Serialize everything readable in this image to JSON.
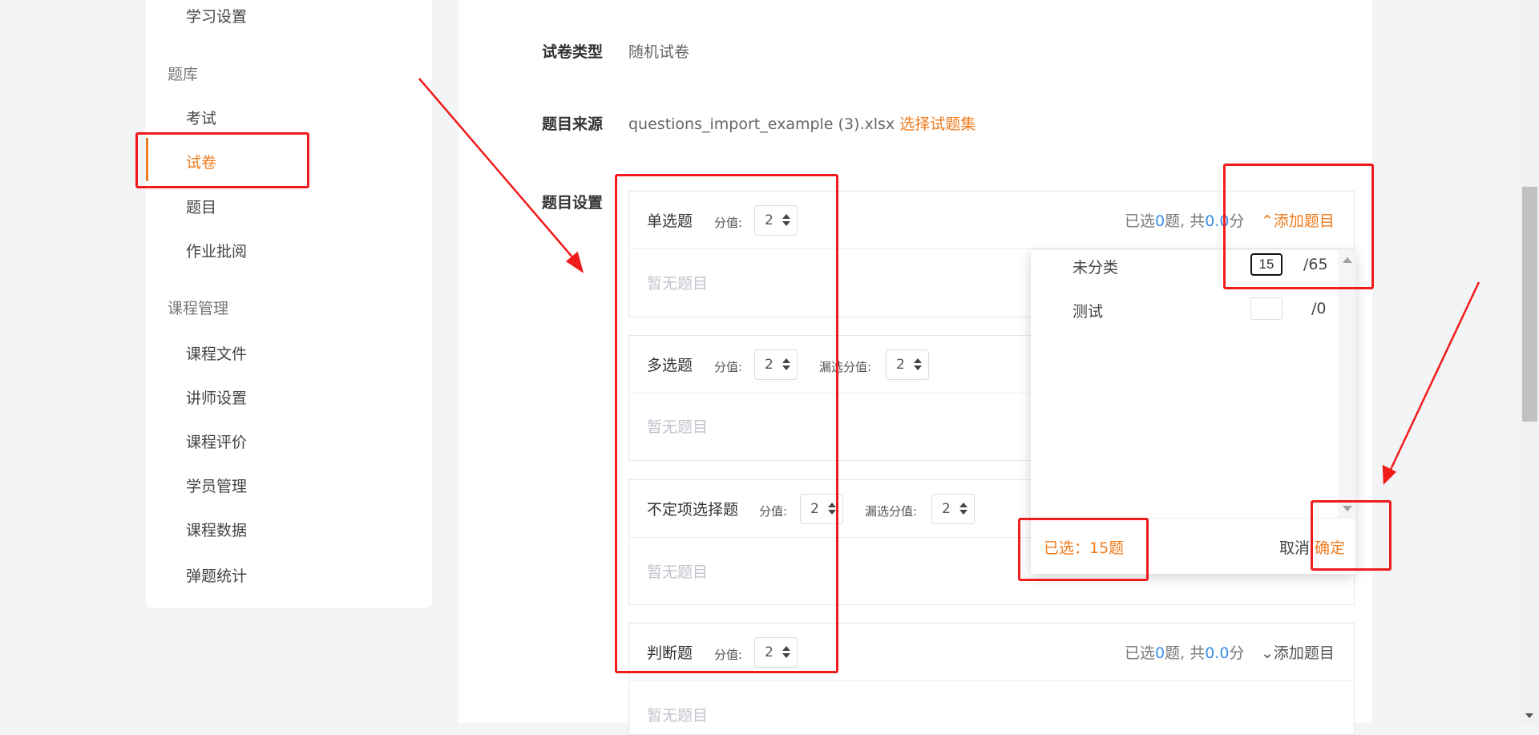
{
  "sidebar": {
    "items": [
      {
        "label": "学习设置",
        "type": "item"
      },
      {
        "label": "题库",
        "type": "group"
      },
      {
        "label": "考试",
        "type": "item"
      },
      {
        "label": "试卷",
        "type": "item",
        "active": true
      },
      {
        "label": "题目",
        "type": "item"
      },
      {
        "label": "作业批阅",
        "type": "item"
      },
      {
        "label": "课程管理",
        "type": "group"
      },
      {
        "label": "课程文件",
        "type": "item"
      },
      {
        "label": "讲师设置",
        "type": "item"
      },
      {
        "label": "课程评价",
        "type": "item"
      },
      {
        "label": "学员管理",
        "type": "item"
      },
      {
        "label": "课程数据",
        "type": "item"
      },
      {
        "label": "弹题统计",
        "type": "item"
      }
    ]
  },
  "form": {
    "paper_type_label": "试卷类型",
    "paper_type_value": "随机试卷",
    "source_label": "题目来源",
    "source_file": "questions_import_example (3).xlsx",
    "source_link": "选择试题集",
    "settings_label": "题目设置"
  },
  "question_types": [
    {
      "title": "单选题",
      "score_label": "分值:",
      "score": "2",
      "stat_prefix": "已选",
      "count": "0",
      "stat_mid": "题, 共",
      "points": "0.0",
      "stat_suffix": "分",
      "add_label": "添加题目",
      "empty": "暂无题目"
    },
    {
      "title": "多选题",
      "score_label": "分值:",
      "score": "2",
      "partial_label": "漏选分值:",
      "partial": "2",
      "empty": "暂无题目"
    },
    {
      "title": "不定项选择题",
      "score_label": "分值:",
      "score": "2",
      "partial_label": "漏选分值:",
      "partial": "2",
      "empty": "暂无题目"
    },
    {
      "title": "判断题",
      "score_label": "分值:",
      "score": "2",
      "stat_prefix": "已选",
      "count": "0",
      "stat_mid": "题, 共",
      "points": "0.0",
      "stat_suffix": "分",
      "add_label": "添加题目",
      "empty": "暂无题目"
    }
  ],
  "dropdown": {
    "rows": [
      {
        "name": "未分类",
        "value": "15",
        "total": "/65"
      },
      {
        "name": "测试",
        "value": "",
        "total": "/0"
      }
    ],
    "selected_text": "已选：15题",
    "cancel": "取消",
    "ok": "确定"
  },
  "colors": {
    "accent": "#f07b1d",
    "link_blue": "#3a8ee6",
    "annotation": "#f01b1b"
  }
}
